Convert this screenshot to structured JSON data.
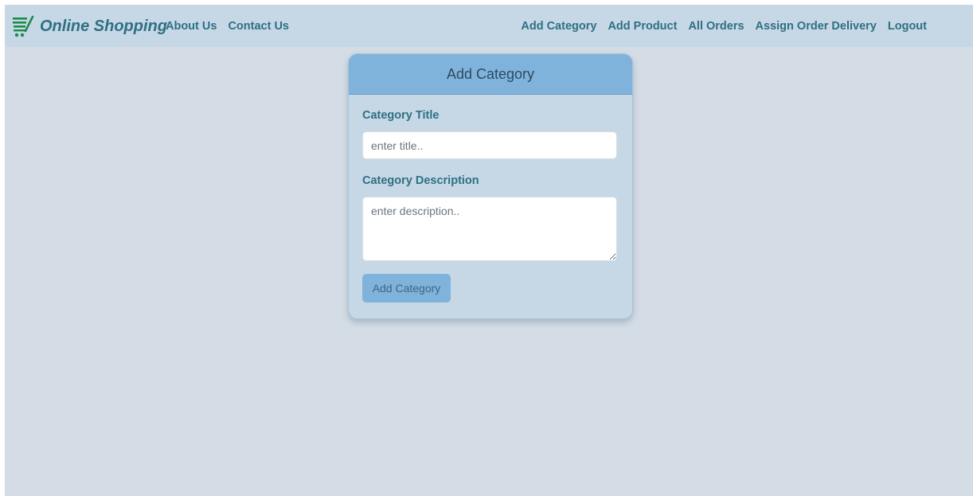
{
  "navbar": {
    "brand": "Online Shopping",
    "brand_icon": "shopping-cart-icon",
    "left_links": [
      "About Us",
      "Contact Us"
    ],
    "right_links": [
      "Add Category",
      "Add Product",
      "All Orders",
      "Assign Order Delivery",
      "Logout"
    ]
  },
  "form": {
    "title": "Add Category",
    "title_label": "Category Title",
    "title_value": "",
    "title_placeholder": "enter title..",
    "description_label": "Category Description",
    "description_value": "",
    "description_placeholder": "enter description..",
    "submit_label": "Add Category"
  },
  "colors": {
    "background": "#d4dde5",
    "navbar": "#c6d8e5",
    "accent": "#80b3dc",
    "link": "#2f6f84",
    "cart_icon": "#1e8a4a"
  }
}
